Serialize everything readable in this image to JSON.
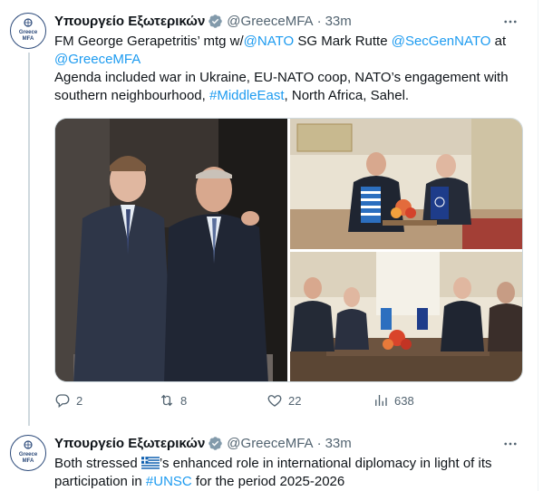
{
  "tweets": [
    {
      "author": "Υπουργείο Εξωτερικών",
      "handle": "@GreeceMFA",
      "separator": "·",
      "time": "33m",
      "avatar_text": [
        "Greece",
        "MFA"
      ],
      "text": [
        {
          "t": "FM George Gerapetritis’ mtg w/",
          "link": false
        },
        {
          "t": "@NATO",
          "link": true
        },
        {
          "t": " SG Mark Rutte ",
          "link": false
        },
        {
          "t": "@SecGenNATO",
          "link": true
        },
        {
          "t": " at ",
          "link": false
        },
        {
          "t": "@GreeceMFA",
          "link": true
        },
        {
          "t": " Agenda included war in Ukraine, EU-NATO coop, NATO’s engagement with southern neighbourhood, ",
          "link": false
        },
        {
          "t": "#MiddleEast",
          "link": true
        },
        {
          "t": ", North Africa, Sahel.",
          "link": false
        }
      ],
      "stats": {
        "replies": "2",
        "reposts": "8",
        "likes": "22",
        "views": "638"
      }
    },
    {
      "author": "Υπουργείο Εξωτερικών",
      "handle": "@GreeceMFA",
      "separator": "·",
      "time": "33m",
      "avatar_text": [
        "Greece",
        "MFA"
      ],
      "text": [
        {
          "t": "Both stressed ",
          "link": false
        },
        {
          "t": "’s enhanced role in international diplomacy in light of its participation in ",
          "link": false
        },
        {
          "t": "#UNSC",
          "link": true
        },
        {
          "t": " for the period 2025-2026",
          "link": false
        }
      ]
    }
  ],
  "icons": {
    "verified": "verified-badge-icon",
    "more": "more-icon",
    "reply": "reply-icon",
    "repost": "repost-icon",
    "like": "like-icon",
    "views": "views-icon",
    "flag": "greek-flag-icon"
  },
  "colors": {
    "link": "#1d9bf0",
    "text": "#0f1419",
    "muted": "#536471",
    "verified_badge": "#829aab",
    "line": "#cfd9de"
  }
}
